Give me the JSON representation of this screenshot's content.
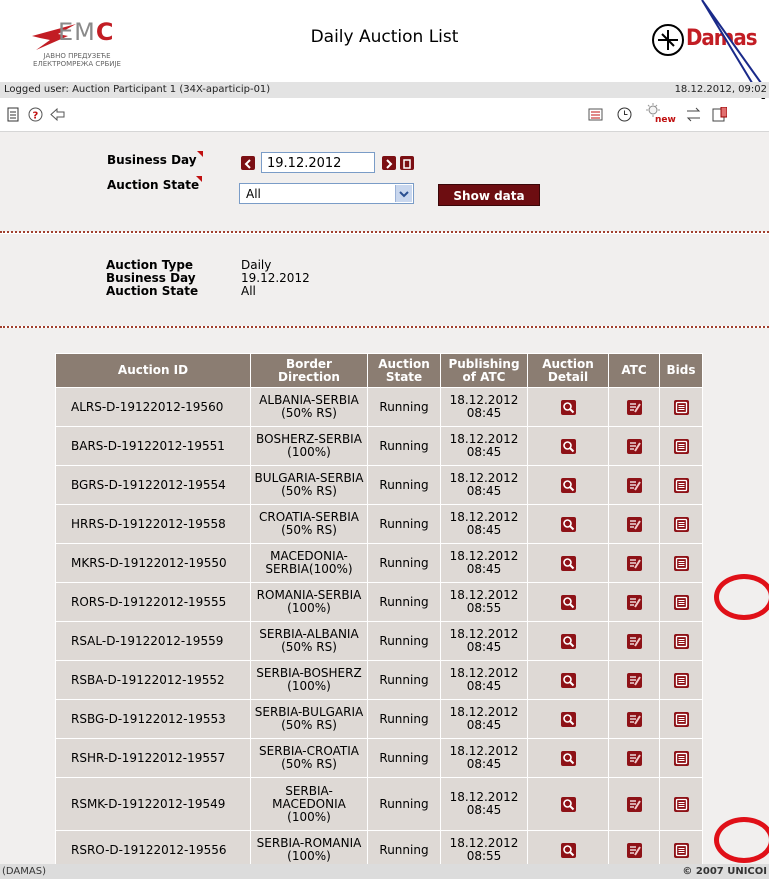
{
  "header": {
    "logo_word_prefix": "EM",
    "logo_word_accent": "C",
    "logo_sub_line1": "ЈАВНО ПРЕДУЗЕЋЕ",
    "logo_sub_line2": "ЕЛЕКТРОМРЕЖА СРБИЈЕ",
    "page_title": "Daily Auction List",
    "damas_text": "Damas"
  },
  "userbar": {
    "logged_user": "Logged user: Auction Participant 1 (34X-aparticip-01)",
    "datetime": "18.12.2012, 09:02"
  },
  "toolbar": {
    "left_icons": [
      "document-icon",
      "help-icon",
      "back-arrow-icon"
    ],
    "right_icons": [
      "list-icon",
      "clock-icon",
      "new-icon",
      "transfer-icon",
      "alert-icon"
    ],
    "new_badge": "new"
  },
  "filter": {
    "business_day_label": "Business Day",
    "business_day_value": "19.12.2012",
    "auction_state_label": "Auction State",
    "auction_state_value": "All",
    "show_button": "Show data"
  },
  "summary": {
    "auction_type_label": "Auction Type",
    "auction_type_value": "Daily",
    "business_day_label": "Business Day",
    "business_day_value": "19.12.2012",
    "auction_state_label": "Auction State",
    "auction_state_value": "All"
  },
  "table": {
    "headers": {
      "auction_id": "Auction ID",
      "border_direction": [
        "Border",
        "Direction"
      ],
      "auction_state": [
        "Auction",
        "State"
      ],
      "publishing": [
        "Publishing",
        "of ATC"
      ],
      "detail": [
        "Auction",
        "Detail"
      ],
      "atc": "ATC",
      "bids": "Bids"
    },
    "rows": [
      {
        "id": "ALRS-D-19122012-19560",
        "dir": [
          "ALBANIA-SERBIA",
          "(50% RS)"
        ],
        "state": "Running",
        "pub": [
          "18.12.2012",
          "08:45"
        ]
      },
      {
        "id": "BARS-D-19122012-19551",
        "dir": [
          "BOSHERZ-SERBIA",
          "(100%)"
        ],
        "state": "Running",
        "pub": [
          "18.12.2012",
          "08:45"
        ]
      },
      {
        "id": "BGRS-D-19122012-19554",
        "dir": [
          "BULGARIA-SERBIA",
          "(50% RS)"
        ],
        "state": "Running",
        "pub": [
          "18.12.2012",
          "08:45"
        ]
      },
      {
        "id": "HRRS-D-19122012-19558",
        "dir": [
          "CROATIA-SERBIA",
          "(50% RS)"
        ],
        "state": "Running",
        "pub": [
          "18.12.2012",
          "08:45"
        ]
      },
      {
        "id": "MKRS-D-19122012-19550",
        "dir": [
          "MACEDONIA-",
          "SERBIA(100%)"
        ],
        "state": "Running",
        "pub": [
          "18.12.2012",
          "08:45"
        ]
      },
      {
        "id": "RORS-D-19122012-19555",
        "dir": [
          "ROMANIA-SERBIA",
          "(100%)"
        ],
        "state": "Running",
        "pub": [
          "18.12.2012",
          "08:55"
        ]
      },
      {
        "id": "RSAL-D-19122012-19559",
        "dir": [
          "SERBIA-ALBANIA",
          "(50% RS)"
        ],
        "state": "Running",
        "pub": [
          "18.12.2012",
          "08:45"
        ]
      },
      {
        "id": "RSBA-D-19122012-19552",
        "dir": [
          "SERBIA-BOSHERZ",
          "(100%)"
        ],
        "state": "Running",
        "pub": [
          "18.12.2012",
          "08:45"
        ]
      },
      {
        "id": "RSBG-D-19122012-19553",
        "dir": [
          "SERBIA-BULGARIA",
          "(50% RS)"
        ],
        "state": "Running",
        "pub": [
          "18.12.2012",
          "08:45"
        ]
      },
      {
        "id": "RSHR-D-19122012-19557",
        "dir": [
          "SERBIA-CROATIA",
          "(50% RS)"
        ],
        "state": "Running",
        "pub": [
          "18.12.2012",
          "08:45"
        ]
      },
      {
        "id": "RSMK-D-19122012-19549",
        "dir": [
          "SERBIA-",
          "MACEDONIA",
          "(100%)"
        ],
        "state": "Running",
        "pub": [
          "18.12.2012",
          "08:45"
        ]
      },
      {
        "id": "RSRO-D-19122012-19556",
        "dir": [
          "SERBIA-ROMANIA",
          "(100%)"
        ],
        "state": "Running",
        "pub": [
          "18.12.2012",
          "08:55"
        ]
      }
    ]
  },
  "footer": {
    "left": "(DAMAS)",
    "right": "© 2007 UNICOI"
  },
  "colors": {
    "accent": "#6d0d11",
    "header_row": "#8b7d72",
    "cell": "#ded9d5",
    "panel": "#f1efee",
    "highlight_ring": "#e01018"
  }
}
